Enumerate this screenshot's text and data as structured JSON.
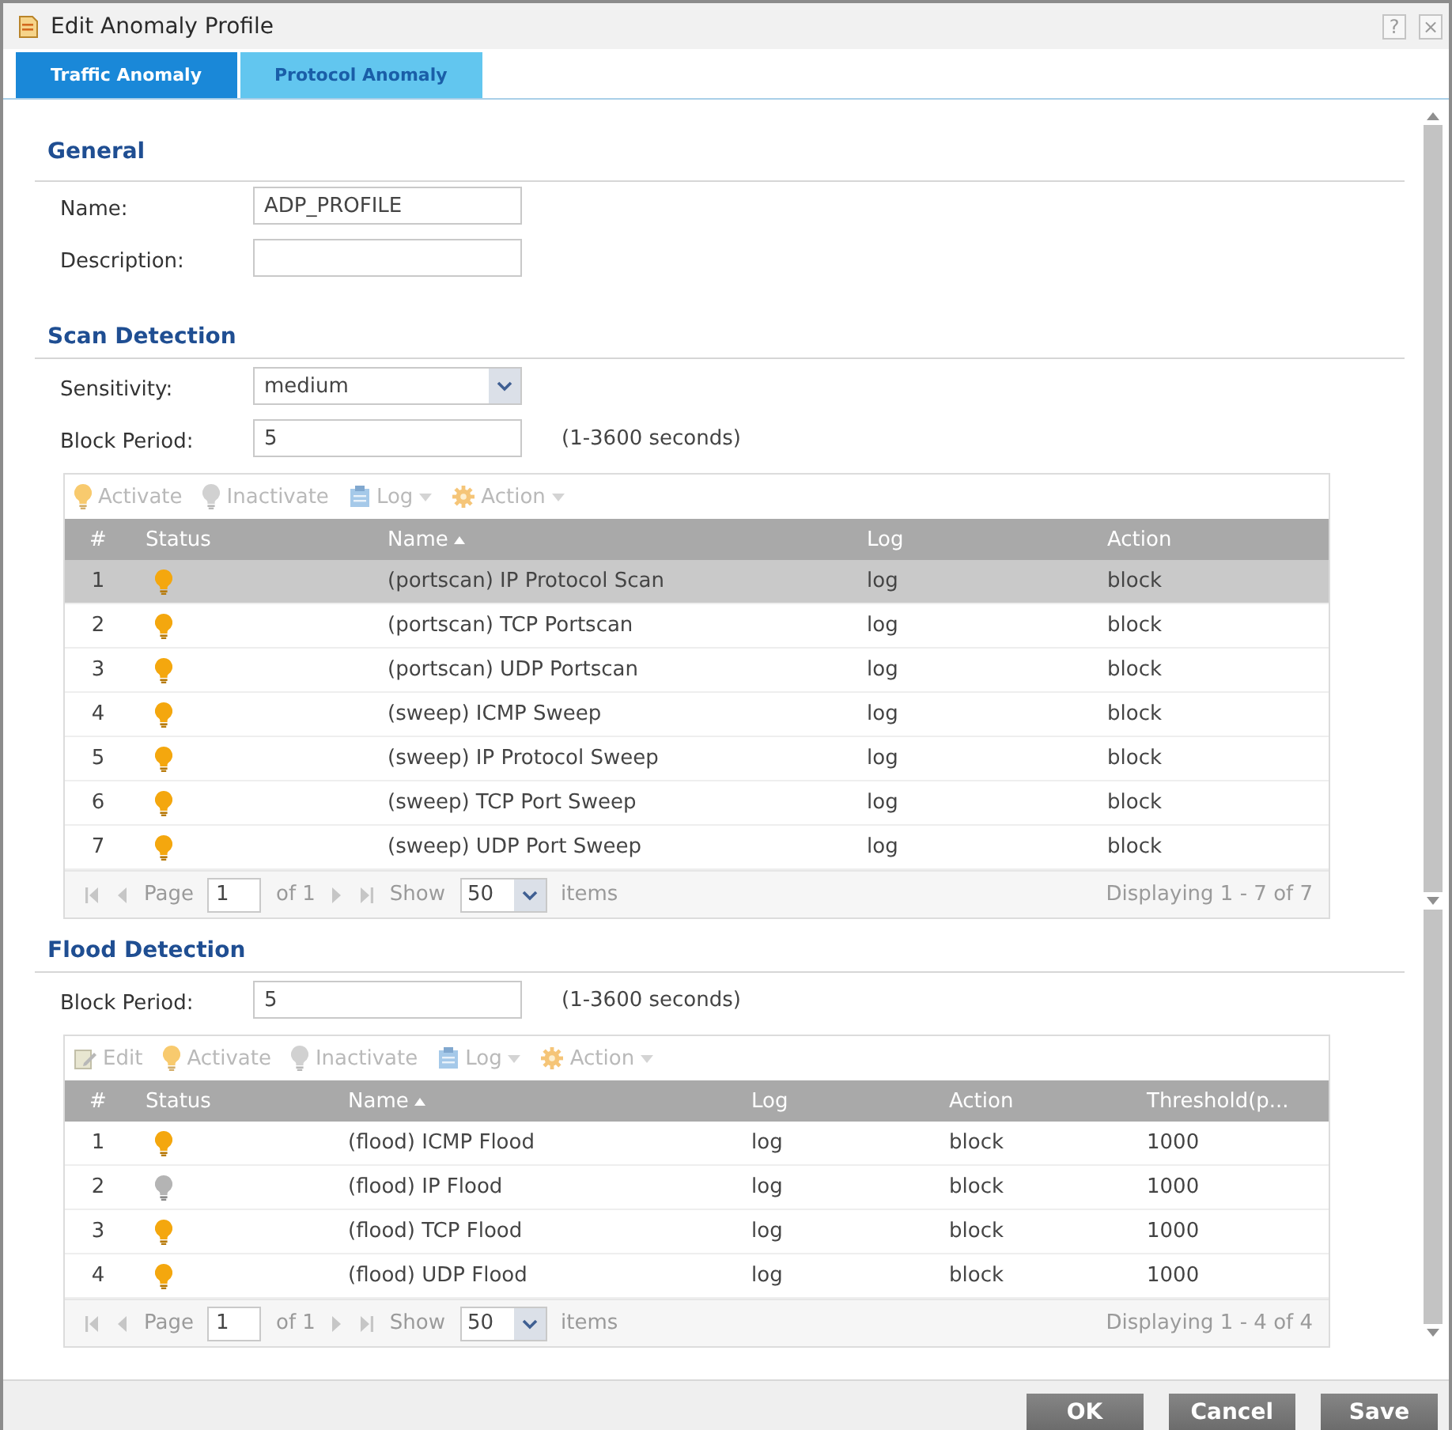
{
  "window": {
    "title": "Edit Anomaly Profile",
    "help": "?",
    "close": "×"
  },
  "tabs": [
    {
      "label": "Traffic Anomaly",
      "selected": true
    },
    {
      "label": "Protocol Anomaly",
      "selected": false
    }
  ],
  "general": {
    "heading": "General",
    "fields": [
      {
        "label": "Name:",
        "kind": "text",
        "value": "ADP_PROFILE"
      },
      {
        "label": "Description:",
        "kind": "text"
      }
    ]
  },
  "scan_detection": {
    "heading": "Scan Detection",
    "fields": [
      {
        "label": "Sensitivity:",
        "kind": "select",
        "value": "medium"
      },
      {
        "label": "Block Period:",
        "kind": "text",
        "value": "5",
        "hint": "(1-3600 seconds)"
      }
    ],
    "table": {
      "toolbar": [
        {
          "label": "Activate",
          "kind": "activate",
          "menu": false,
          "disabled": true
        },
        {
          "label": "Inactivate",
          "kind": "inactivate",
          "menu": false,
          "disabled": true
        },
        {
          "label": "Log",
          "kind": "log",
          "menu": true,
          "disabled": true
        },
        {
          "label": "Action",
          "kind": "action",
          "menu": true,
          "disabled": true
        }
      ],
      "columns": [
        {
          "label": "#",
          "kind": "number",
          "sorted": false
        },
        {
          "label": "Status",
          "kind": "status",
          "sorted": false
        },
        {
          "label": "Name",
          "kind": "text",
          "sorted": true
        },
        {
          "label": "Log",
          "kind": "text",
          "sorted": false
        },
        {
          "label": "Action",
          "kind": "text",
          "sorted": false
        }
      ],
      "rows": [
        {
          "number": "1",
          "active": true,
          "values": [
            "(portscan) IP Protocol Scan",
            "log",
            "block"
          ],
          "selected": true
        },
        {
          "number": "2",
          "active": true,
          "values": [
            "(portscan) TCP Portscan",
            "log",
            "block"
          ],
          "selected": false
        },
        {
          "number": "3",
          "active": true,
          "values": [
            "(portscan) UDP Portscan",
            "log",
            "block"
          ],
          "selected": false
        },
        {
          "number": "4",
          "active": true,
          "values": [
            "(sweep) ICMP Sweep",
            "log",
            "block"
          ],
          "selected": false
        },
        {
          "number": "5",
          "active": true,
          "values": [
            "(sweep) IP Protocol Sweep",
            "log",
            "block"
          ],
          "selected": false
        },
        {
          "number": "6",
          "active": true,
          "values": [
            "(sweep) TCP Port Sweep",
            "log",
            "block"
          ],
          "selected": false
        },
        {
          "number": "7",
          "active": true,
          "values": [
            "(sweep) UDP Port Sweep",
            "log",
            "block"
          ],
          "selected": false
        }
      ],
      "pager": {
        "page_label": "Page",
        "page": "1",
        "total": "of 1",
        "show_label": "Show",
        "per_page": "50",
        "items_label": "items",
        "summary": "Displaying 1 - 7 of 7"
      }
    }
  },
  "flood_detection": {
    "heading": "Flood Detection",
    "fields": [
      {
        "label": "Block Period:",
        "kind": "text",
        "value": "5",
        "hint": "(1-3600 seconds)"
      }
    ],
    "table": {
      "toolbar": [
        {
          "label": "Edit",
          "kind": "edit",
          "menu": false,
          "disabled": true
        },
        {
          "label": "Activate",
          "kind": "activate",
          "menu": false,
          "disabled": true
        },
        {
          "label": "Inactivate",
          "kind": "inactivate",
          "menu": false,
          "disabled": true
        },
        {
          "label": "Log",
          "kind": "log",
          "menu": true,
          "disabled": true
        },
        {
          "label": "Action",
          "kind": "action",
          "menu": true,
          "disabled": true
        }
      ],
      "columns": [
        {
          "label": "#",
          "kind": "number",
          "sorted": false
        },
        {
          "label": "Status",
          "kind": "status",
          "sorted": false
        },
        {
          "label": "Name",
          "kind": "text",
          "sorted": true
        },
        {
          "label": "Log",
          "kind": "text",
          "sorted": false
        },
        {
          "label": "Action",
          "kind": "text",
          "sorted": false
        },
        {
          "label": "Threshold(p...",
          "kind": "text",
          "sorted": false
        }
      ],
      "rows": [
        {
          "number": "1",
          "active": true,
          "values": [
            "(flood) ICMP Flood",
            "log",
            "block",
            "1000"
          ],
          "selected": false
        },
        {
          "number": "2",
          "active": false,
          "values": [
            "(flood) IP Flood",
            "log",
            "block",
            "1000"
          ],
          "selected": false
        },
        {
          "number": "3",
          "active": true,
          "values": [
            "(flood) TCP Flood",
            "log",
            "block",
            "1000"
          ],
          "selected": false
        },
        {
          "number": "4",
          "active": true,
          "values": [
            "(flood) UDP Flood",
            "log",
            "block",
            "1000"
          ],
          "selected": false
        }
      ],
      "pager": {
        "page_label": "Page",
        "page": "1",
        "total": "of 1",
        "show_label": "Show",
        "per_page": "50",
        "items_label": "items",
        "summary": "Displaying 1 - 4 of 4"
      }
    }
  },
  "buttons": [
    {
      "label": "OK"
    },
    {
      "label": "Cancel"
    },
    {
      "label": "Save"
    }
  ]
}
